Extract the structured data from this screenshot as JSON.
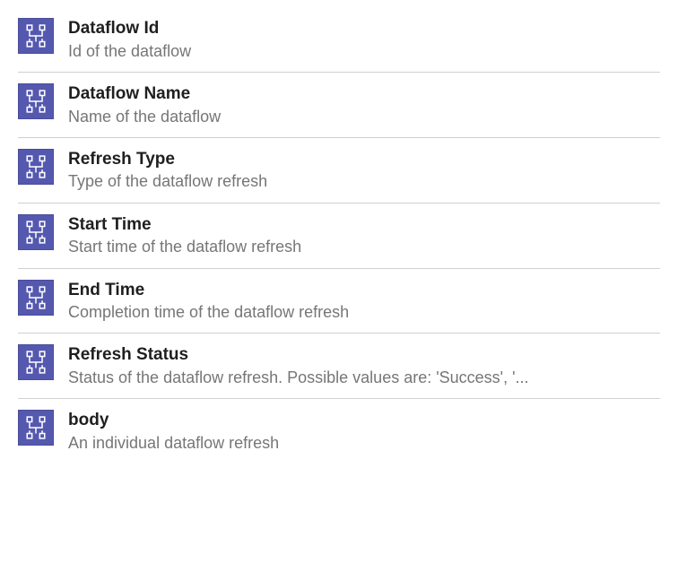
{
  "items": [
    {
      "title": "Dataflow Id",
      "description": "Id of the dataflow"
    },
    {
      "title": "Dataflow Name",
      "description": "Name of the dataflow"
    },
    {
      "title": "Refresh Type",
      "description": "Type of the dataflow refresh"
    },
    {
      "title": "Start Time",
      "description": "Start time of the dataflow refresh"
    },
    {
      "title": "End Time",
      "description": "Completion time of the dataflow refresh"
    },
    {
      "title": "Refresh Status",
      "description": "Status of the dataflow refresh. Possible values are: 'Success', '..."
    },
    {
      "title": "body",
      "description": "An individual dataflow refresh"
    }
  ]
}
